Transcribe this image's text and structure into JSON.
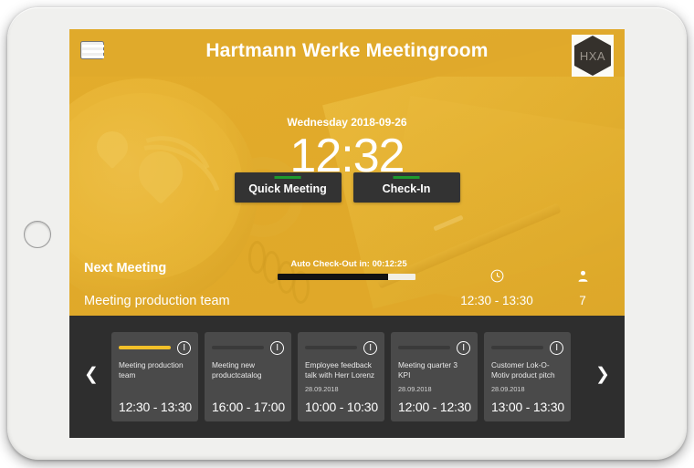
{
  "device": {
    "home_button_name": "home-button"
  },
  "header": {
    "menu_icon": "hamburger-menu-icon",
    "title": "Hartmann Werke Meetingroom",
    "logo_text": "HXA"
  },
  "clock": {
    "date": "Wednesday 2018-09-26",
    "time": "12:32"
  },
  "actions": [
    {
      "label": "Quick Meeting",
      "accent": "#1e9a2e"
    },
    {
      "label": "Check-In",
      "accent": "#1e9a2e"
    }
  ],
  "next_meeting": {
    "heading": "Next Meeting",
    "title": "Meeting production team",
    "checkout_label": "Auto Check-Out in:   00:12:25",
    "checkout_progress_percent": 80,
    "clock_icon": "clock-icon",
    "people_icon": "person-icon",
    "time_range": "12:30 - 13:30",
    "attendees": "7"
  },
  "carousel": {
    "prev_icon": "chevron-left-icon",
    "next_icon": "chevron-right-icon",
    "prev_glyph": "❮",
    "next_glyph": "❯",
    "cards": [
      {
        "title": "Meeting production team",
        "date": "",
        "time": "12:30 - 13:30",
        "active": true
      },
      {
        "title": "Meeting new productcatalog",
        "date": "",
        "time": "16:00 - 17:00",
        "active": false
      },
      {
        "title": "Employee feedback talk with Herr Lorenz",
        "date": "28.09.2018",
        "time": "10:00 - 10:30",
        "active": false
      },
      {
        "title": "Meeting quarter 3 KPI",
        "date": "28.09.2018",
        "time": "12:00 - 12:30",
        "active": false
      },
      {
        "title": "Customer Lok-O-Motiv product pitch",
        "date": "28.09.2018",
        "time": "13:00 - 13:30",
        "active": false
      }
    ]
  },
  "colors": {
    "brand_yellow": "#e0a92b",
    "card_accent": "#f2c029",
    "button_dark": "#333333",
    "carousel_bg": "#2e2e2e"
  }
}
